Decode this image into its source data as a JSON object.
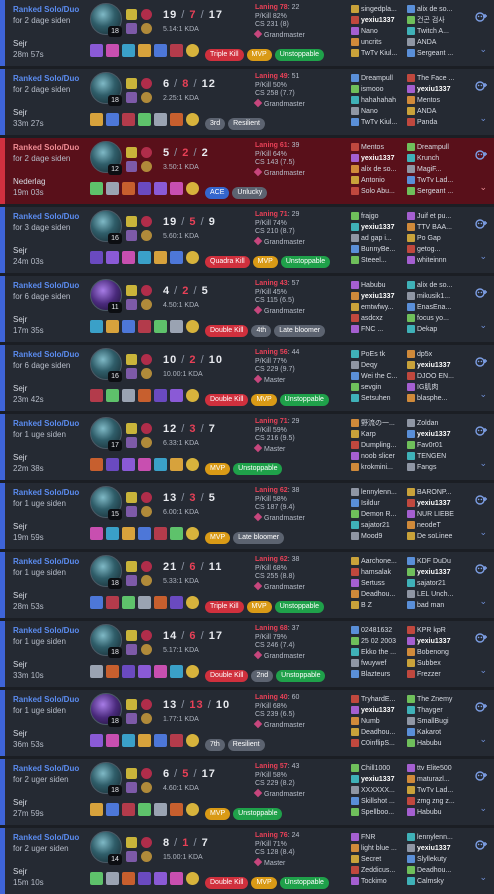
{
  "matches": [
    {
      "queue": "Ranked Solo/Duo",
      "ago": "for 2 dage siden",
      "result": "Sejr",
      "duration": "28m 57s",
      "level": "18",
      "kda": {
        "k": "19",
        "d": "7",
        "a": "17"
      },
      "ratio": "5.14:1 KDA",
      "laning": {
        "label": "Laning 78",
        "score": ": 22"
      },
      "pkill": "P/Kill 82%",
      "cs": "CS 231 (8)",
      "rank": "Grandmaster",
      "tags": [
        {
          "text": "Triple Kill",
          "c": "red"
        },
        {
          "text": "MVP",
          "c": "orange"
        },
        {
          "text": "Unstoppable",
          "c": "green"
        }
      ],
      "team1": [
        "singedpla...",
        "yexiu1337",
        "Nano",
        "uncrits",
        "TwTv Kiul..."
      ],
      "team2": [
        "alix de so...",
        "건곤 검사",
        "Twitch A...",
        "ANDA",
        "Sergeant ..."
      ],
      "win": true
    },
    {
      "queue": "Ranked Solo/Duo",
      "ago": "for 2 dage siden",
      "result": "Sejr",
      "duration": "33m 27s",
      "level": "18",
      "kda": {
        "k": "6",
        "d": "8",
        "a": "12"
      },
      "ratio": "2.25:1 KDA",
      "laning": {
        "label": "Laning 49",
        "score": ": 51"
      },
      "pkill": "P/Kill 50%",
      "cs": "CS 258 (7.7)",
      "rank": "Grandmaster",
      "tags": [
        {
          "text": "3rd",
          "c": "gray"
        },
        {
          "text": "Resilient",
          "c": "gray"
        }
      ],
      "team1": [
        "Dreampull",
        "ismooo",
        "hahahahah",
        "Nano",
        "TwTv Kiul..."
      ],
      "team2": [
        "The Face ...",
        "yexiu1337",
        "Mentos",
        "ANDA",
        "Panda"
      ],
      "win": true
    },
    {
      "queue": "Ranked Solo/Duo",
      "ago": "for 2 dage siden",
      "result": "Nederlag",
      "duration": "19m 03s",
      "level": "12",
      "kda": {
        "k": "5",
        "d": "2",
        "a": "2"
      },
      "ratio": "3.50:1 KDA",
      "laning": {
        "label": "Laning 61",
        "score": ": 39"
      },
      "pkill": "P/Kill 64%",
      "cs": "CS 143 (7.5)",
      "rank": "Grandmaster",
      "tags": [
        {
          "text": "ACE",
          "c": "blue"
        },
        {
          "text": "Unlucky",
          "c": "gray"
        }
      ],
      "team1": [
        "Mentos",
        "yexiu1337",
        "alix de so...",
        "Antonio",
        "Solo Abu..."
      ],
      "team2": [
        "Dreampull",
        "Krunch",
        "MagiF...",
        "TwTv Lad...",
        "Sergeant ..."
      ],
      "win": false
    },
    {
      "queue": "Ranked Solo/Duo",
      "ago": "for 3 dage siden",
      "result": "Sejr",
      "duration": "24m 03s",
      "level": "16",
      "kda": {
        "k": "19",
        "d": "5",
        "a": "9"
      },
      "ratio": "5.60:1 KDA",
      "laning": {
        "label": "Laning 71",
        "score": ": 29"
      },
      "pkill": "P/Kill 74%",
      "cs": "CS 210 (8.7)",
      "rank": "Grandmaster",
      "tags": [
        {
          "text": "Quadra Kill",
          "c": "red"
        },
        {
          "text": "MVP",
          "c": "orange"
        },
        {
          "text": "Unstoppable",
          "c": "green"
        }
      ],
      "team1": [
        "frajgo",
        "yexiu1337",
        "ad gap i...",
        "BunnyBe...",
        "Steeel..."
      ],
      "team2": [
        "Juif et pu...",
        "TTV BAA...",
        "Po Gap",
        "getog...",
        "whiteinnn"
      ],
      "win": true
    },
    {
      "queue": "Ranked Solo/Duo",
      "ago": "for 6 dage siden",
      "result": "Sejr",
      "duration": "17m 35s",
      "level": "11",
      "kda": {
        "k": "4",
        "d": "2",
        "a": "5"
      },
      "ratio": "4.50:1 KDA",
      "laning": {
        "label": "Laning 43",
        "score": ": 57"
      },
      "pkill": "P/Kill 45%",
      "cs": "CS 115 (6.5)",
      "rank": "Grandmaster",
      "tags": [
        {
          "text": "Double Kill",
          "c": "red"
        },
        {
          "text": "4th",
          "c": "gray"
        },
        {
          "text": "Late bloomer",
          "c": "gray"
        }
      ],
      "team1": [
        "Habubu",
        "yexiu1337",
        "emtwfwy...",
        "asdcxz",
        "FNC ..."
      ],
      "team2": [
        "alix de so...",
        "mikusik1...",
        "EnasEna...",
        "focus yo...",
        "Dekap"
      ],
      "win": true
    },
    {
      "queue": "Ranked Solo/Duo",
      "ago": "for 6 dage siden",
      "result": "Sejr",
      "duration": "23m 42s",
      "level": "16",
      "kda": {
        "k": "10",
        "d": "2",
        "a": "10"
      },
      "ratio": "10.00:1 KDA",
      "laning": {
        "label": "Laning 56",
        "score": ": 44"
      },
      "pkill": "P/Kill 77%",
      "cs": "CS 229 (9.7)",
      "rank": "Master",
      "tags": [
        {
          "text": "Double Kill",
          "c": "red"
        },
        {
          "text": "MVP",
          "c": "orange"
        },
        {
          "text": "Unstoppable",
          "c": "green"
        }
      ],
      "team1": [
        "PoEs tk",
        "Deqy",
        "Wei the C...",
        "sevgin",
        "Setsuhen"
      ],
      "team2": [
        "dp5x",
        "yexiu1337",
        "DJOO EN...",
        "IG肌肉",
        "blasphe..."
      ],
      "win": true
    },
    {
      "queue": "Ranked Solo/Duo",
      "ago": "for 1 uge siden",
      "result": "Sejr",
      "duration": "22m 38s",
      "level": "17",
      "kda": {
        "k": "12",
        "d": "3",
        "a": "7"
      },
      "ratio": "6.33:1 KDA",
      "laning": {
        "label": "Laning 71",
        "score": ": 29"
      },
      "pkill": "P/Kill 59%",
      "cs": "CS 216 (9.5)",
      "rank": "Master",
      "tags": [
        {
          "text": "MVP",
          "c": "orange"
        },
        {
          "text": "Unstoppable",
          "c": "green"
        }
      ],
      "team1": [
        "野流の一...",
        "Karp",
        "Dumpling...",
        "noob slicer",
        "krokmini..."
      ],
      "team2": [
        "Zoldan",
        "yexiu1337",
        "Fav0r01",
        "TENGEN",
        "Fangs"
      ],
      "win": true
    },
    {
      "queue": "Ranked Solo/Duo",
      "ago": "for 1 uge siden",
      "result": "Sejr",
      "duration": "19m 59s",
      "level": "15",
      "kda": {
        "k": "13",
        "d": "3",
        "a": "5"
      },
      "ratio": "6.00:1 KDA",
      "laning": {
        "label": "Laning 62",
        "score": ": 38"
      },
      "pkill": "P/Kill 58%",
      "cs": "CS 187 (9.4)",
      "rank": "Grandmaster",
      "tags": [
        {
          "text": "MVP",
          "c": "orange"
        },
        {
          "text": "Late bloomer",
          "c": "gray"
        }
      ],
      "team1": [
        "lennylenn...",
        "Isildur",
        "Demon R...",
        "sajator21",
        "Mood9"
      ],
      "team2": [
        "BARONP...",
        "yexiu1337",
        "NUR LIEBE",
        "neodeT",
        "De soLinee"
      ],
      "win": true
    },
    {
      "queue": "Ranked Solo/Duo",
      "ago": "for 1 uge siden",
      "result": "Sejr",
      "duration": "28m 53s",
      "level": "18",
      "kda": {
        "k": "21",
        "d": "6",
        "a": "11"
      },
      "ratio": "5.33:1 KDA",
      "laning": {
        "label": "Laning 62",
        "score": ": 38"
      },
      "pkill": "P/Kill 68%",
      "cs": "CS 255 (8.8)",
      "rank": "Grandmaster",
      "tags": [
        {
          "text": "Triple Kill",
          "c": "red"
        },
        {
          "text": "MVP",
          "c": "orange"
        },
        {
          "text": "Unstoppable",
          "c": "green"
        }
      ],
      "team1": [
        "Aarchone...",
        "hamsalak",
        "Sertuss",
        "Deadhou...",
        "B Z"
      ],
      "team2": [
        "KDF DuDu",
        "yexiu1337",
        "sajator21",
        "LEL Unch...",
        "bad man"
      ],
      "win": true
    },
    {
      "queue": "Ranked Solo/Duo",
      "ago": "for 1 uge siden",
      "result": "Sejr",
      "duration": "33m 10s",
      "level": "18",
      "kda": {
        "k": "14",
        "d": "6",
        "a": "17"
      },
      "ratio": "5.17:1 KDA",
      "laning": {
        "label": "Laning 68",
        "score": ": 37"
      },
      "pkill": "P/Kill 79%",
      "cs": "CS 246 (7.4)",
      "rank": "Grandmaster",
      "tags": [
        {
          "text": "Double Kill",
          "c": "red"
        },
        {
          "text": "2nd",
          "c": "gray"
        },
        {
          "text": "Unstoppable",
          "c": "green"
        }
      ],
      "team1": [
        "02481632",
        "25 02 2003",
        "Ekko the ...",
        "fwuywef",
        "Blazteurs"
      ],
      "team2": [
        "KPR kpR",
        "yexiu1337",
        "Bobenong",
        "Subbex",
        "Frezzer"
      ],
      "win": true
    },
    {
      "queue": "Ranked Solo/Duo",
      "ago": "for 1 uge siden",
      "result": "Sejr",
      "duration": "36m 53s",
      "level": "18",
      "kda": {
        "k": "13",
        "d": "13",
        "a": "10"
      },
      "ratio": "1.77:1 KDA",
      "laning": {
        "label": "Laning 40",
        "score": ": 60"
      },
      "pkill": "P/Kill 68%",
      "cs": "CS 239 (6.5)",
      "rank": "Grandmaster",
      "tags": [
        {
          "text": "7th",
          "c": "gray"
        },
        {
          "text": "Resilient",
          "c": "gray"
        }
      ],
      "team1": [
        "TryhardE...",
        "yexiu1337",
        "Numb",
        "Deadhou...",
        "C0inflipS..."
      ],
      "team2": [
        "The Znemy",
        "Thayger",
        "SmallBugi",
        "Kakarot",
        "Habubu"
      ],
      "win": true
    },
    {
      "queue": "Ranked Solo/Duo",
      "ago": "for 2 uger siden",
      "result": "Sejr",
      "duration": "27m 59s",
      "level": "18",
      "kda": {
        "k": "6",
        "d": "5",
        "a": "17"
      },
      "ratio": "4.60:1 KDA",
      "laning": {
        "label": "Laning 57",
        "score": ": 43"
      },
      "pkill": "P/Kill 58%",
      "cs": "CS 229 (8.2)",
      "rank": "Grandmaster",
      "tags": [
        {
          "text": "MVP",
          "c": "orange"
        },
        {
          "text": "Unstoppable",
          "c": "green"
        }
      ],
      "team1": [
        "Chill1000",
        "yexiu1337",
        "XXXXXX...",
        "Skillshot ...",
        "Spellboo..."
      ],
      "team2": [
        "ttv Elite500",
        "maturazl...",
        "TwTv Lad...",
        "zmg zng z...",
        "Habubu"
      ],
      "win": true
    },
    {
      "queue": "Ranked Solo/Duo",
      "ago": "for 2 uger siden",
      "result": "Sejr",
      "duration": "15m 10s",
      "level": "14",
      "kda": {
        "k": "8",
        "d": "1",
        "a": "7"
      },
      "ratio": "15.00:1 KDA",
      "laning": {
        "label": "Laning 76",
        "score": ": 24"
      },
      "pkill": "P/Kill 71%",
      "cs": "CS 128 (8.4)",
      "rank": "Master",
      "tags": [
        {
          "text": "Double Kill",
          "c": "red"
        },
        {
          "text": "MVP",
          "c": "orange"
        },
        {
          "text": "Unstoppable",
          "c": "green"
        }
      ],
      "team1": [
        "FNR",
        "light blue ...",
        "Secret",
        "Zeddicus...",
        "Tockimo"
      ],
      "team2": [
        "lennylenn...",
        "yexiu1337",
        "Slyllekuty",
        "Deadhou...",
        "Calmsky"
      ],
      "win": true
    }
  ],
  "colors": {
    "win_bar": "#3e64d8",
    "loss_bar": "#d1303f",
    "loss_bg": "#59101a",
    "death": "#e84057"
  }
}
